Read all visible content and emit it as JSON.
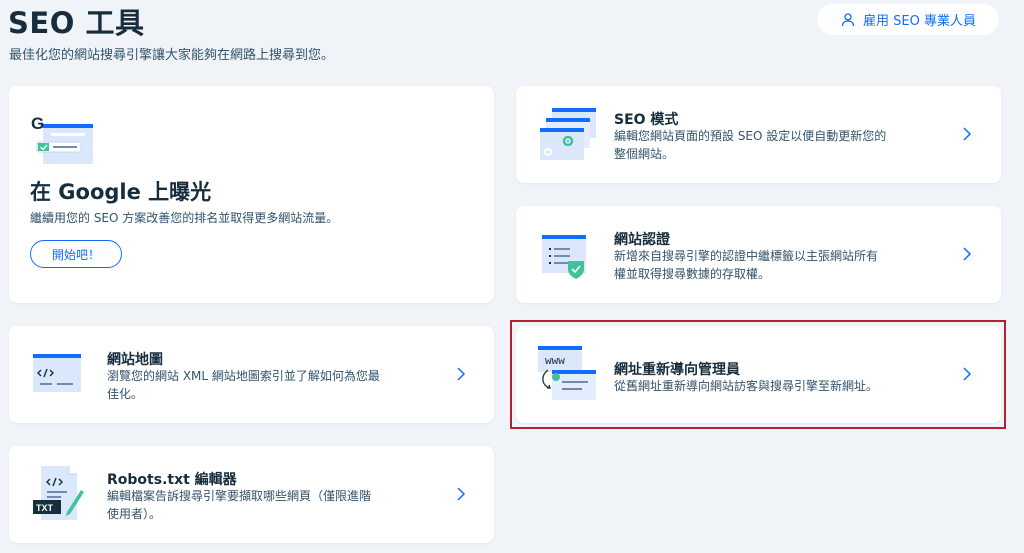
{
  "header": {
    "title": "SEO 工具",
    "subtitle": "最佳化您的網站搜尋引擎讓大家能夠在網路上搜尋到您。",
    "hire_label": "雇用 SEO 專業人員"
  },
  "hero": {
    "title": "在 Google 上曝光",
    "description": "繼續用您的 SEO 方案改善您的排名並取得更多網站流量。",
    "button_label": "開始吧！"
  },
  "cards": [
    {
      "title": "SEO 模式",
      "desc1": "編輯您網站頁面的預設 SEO 設定以便自動更新您的",
      "desc2": "整個網站。",
      "icon": "seo-settings-icon"
    },
    {
      "title": "網站認證",
      "desc1": "新增來自搜尋引擎的認證中繼標籤以主張網站所有",
      "desc2": "權並取得搜尋數據的存取權。",
      "icon": "site-verification-icon"
    },
    {
      "title": "網站地圖",
      "desc1": "瀏覽您的網站 XML 網站地圖索引並了解如何為您最",
      "desc2": "佳化。",
      "icon": "sitemap-icon"
    },
    {
      "title": "網址重新導向管理員",
      "desc1": "從舊網址重新導向網站訪客與搜尋引擎至新網址。",
      "desc2": "",
      "icon": "url-redirect-icon"
    },
    {
      "title": "Robots.txt 編輯器",
      "desc1": "編輯檔案告訴搜尋引擎要擷取哪些網頁（僅限進階",
      "desc2": "使用者）。",
      "icon": "robots-txt-icon"
    }
  ],
  "icon_text": {
    "www": "www",
    "txt": "TXT",
    "google_g": "G"
  },
  "colors": {
    "accent": "#116dff",
    "highlight_border": "#b3202f",
    "background": "#f0f3f8"
  }
}
